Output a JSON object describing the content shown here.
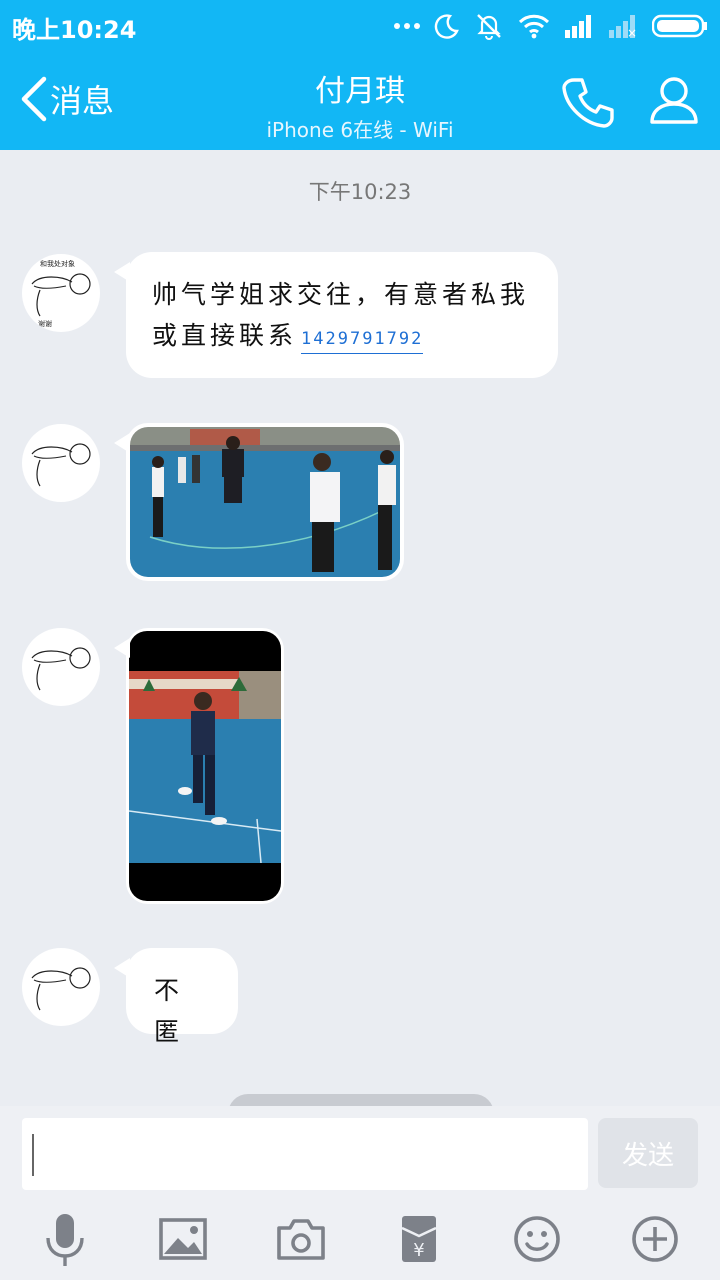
{
  "status_bar": {
    "time": "晚上10:24",
    "icons": [
      "more-dots-icon",
      "moon-icon",
      "mute-icon",
      "wifi-icon",
      "signal-icon",
      "signal-no-sim-icon",
      "battery-icon"
    ]
  },
  "header": {
    "back_label": "消息",
    "title": "付月琪",
    "subtitle": "iPhone 6在线 - WiFi",
    "actions": [
      "phone-icon",
      "profile-icon"
    ]
  },
  "chat": {
    "timestamp": "下午10:23",
    "messages": [
      {
        "type": "text",
        "text": "帅气学姐求交往，有意者私我或直接联系",
        "link": "1429791792"
      },
      {
        "type": "image",
        "content": "jump-rope-group-photo"
      },
      {
        "type": "image",
        "content": "jump-rope-single-photo"
      },
      {
        "type": "text",
        "text": "不匿"
      }
    ],
    "avatar_text_top": "和我处对象",
    "avatar_text_bottom": "谢谢"
  },
  "composer": {
    "input_value": "",
    "send_label": "发送"
  },
  "toolbar": {
    "tools": [
      "microphone-icon",
      "image-icon",
      "camera-icon",
      "red-packet-icon",
      "emoji-icon",
      "plus-icon"
    ]
  },
  "colors": {
    "header_blue": "#12b7f5",
    "chat_background": "#eaedf2",
    "link_blue": "#1e6fd4"
  }
}
